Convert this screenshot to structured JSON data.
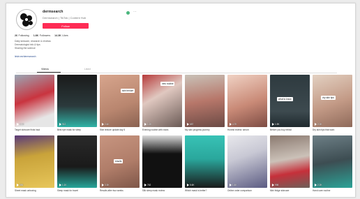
{
  "profile": {
    "username": "dermsearch",
    "nickname": "Dermsearch | TikTok | Content Hub",
    "follow_label": "Follow",
    "stats": [
      {
        "value": "26",
        "label": "Following"
      },
      {
        "value": "1.8K",
        "label": "Followers"
      },
      {
        "value": "14.3K",
        "label": "Likes"
      }
    ],
    "bio_lines": [
      "Daily skincare, research & reviews",
      "Dermatologist info & tips",
      "Sharing the science"
    ],
    "link": "linktr.ee/dermsearch"
  },
  "tabs": [
    "Videos",
    "Liked"
  ],
  "colors": {
    "accent": "#fe2c55",
    "online": "#4ab67d"
  },
  "videos": [
    {
      "bg": "linear-gradient(160deg,#9aa7b5 0%,#c9343f 45%,#e6e6e6 80%)",
      "caption": "",
      "views": "3.1K",
      "desc": "Target skincare finds haul"
    },
    {
      "bg": "linear-gradient(180deg,#1a1a1a 0%,#2b3a3c 60%,#2fb3a6 100%)",
      "caption": "",
      "views": "912",
      "desc": "Best eye mask for sleep"
    },
    {
      "bg": "linear-gradient(160deg,#d7a58d 0%,#b9866f 60%,#8a6251 100%)",
      "caption": "skin texture",
      "views": "2.4K",
      "desc": "Skin texture update day 5"
    },
    {
      "bg": "linear-gradient(150deg,#b63a3a 0%,#e0c8c0 40%,#6a5a55 100%)",
      "caption": "new routine",
      "views": "1.2K",
      "desc": "Evening routine with roses"
    },
    {
      "bg": "linear-gradient(170deg,#c9c2b8 0%,#b7776a 50%,#6b4a45 100%)",
      "caption": "",
      "views": "687",
      "desc": "My skin progress journey"
    },
    {
      "bg": "linear-gradient(160deg,#f0d2c4 0%,#c98a77 55%,#7d4c44 100%)",
      "caption": "",
      "views": "4.7K",
      "desc": "Honest review: serum"
    },
    {
      "bg": "linear-gradient(180deg,#2e3a3f 0%,#3d4a4f 70%,#1f2a2e 100%)",
      "caption": "what to know",
      "views": "1.9K",
      "desc": "Before you buy retinol"
    },
    {
      "bg": "linear-gradient(160deg,#e3d1c2 0%,#c39a86 55%,#8f6a5a 100%)",
      "caption": "dry skin tips",
      "views": "2.0K",
      "desc": "Dry skin tips that work"
    },
    {
      "bg": "linear-gradient(170deg,#5a3b7a 0%,#c9a33a 40%,#e7c65a 100%)",
      "caption": "",
      "views": "856",
      "desc": "Sheet mask unboxing"
    },
    {
      "bg": "linear-gradient(180deg,#2a2a2a 0%,#1a1a1a 60%,#27a69a 100%)",
      "caption": "",
      "views": "1.1K",
      "desc": "Sleep mask for travel"
    },
    {
      "bg": "linear-gradient(160deg,#c79580 0%,#b07d69 55%,#7e5648 100%)",
      "caption": "results",
      "views": "3.3K",
      "desc": "Results after two weeks"
    },
    {
      "bg": "linear-gradient(180deg,#d9d9d9 0%,#111 35%,#111 100%)",
      "caption": "",
      "views": "742",
      "desc": "Silk sleep mask review"
    },
    {
      "bg": "linear-gradient(180deg,#38c2b6 0%,#2aa79c 45%,#1a1a1a 100%)",
      "caption": "",
      "views": "5.6K",
      "desc": "Which mask is better?"
    },
    {
      "bg": "linear-gradient(160deg,#e8e8ec 0%,#c8c8d4 40%,#5b5b82 100%)",
      "caption": "",
      "views": "1.4K",
      "desc": "Online order comparison"
    },
    {
      "bg": "linear-gradient(170deg,#8b7a70 0%,#cbc1b8 45%,#c6303a 70%,#6d6059 100%)",
      "caption": "",
      "views": "998",
      "desc": "Mini fridge skincare"
    },
    {
      "bg": "linear-gradient(170deg,#6d7f86 0%,#3d4d52 50%,#2ba397 100%)",
      "caption": "",
      "views": "2.2K",
      "desc": "Hand care routine"
    }
  ]
}
